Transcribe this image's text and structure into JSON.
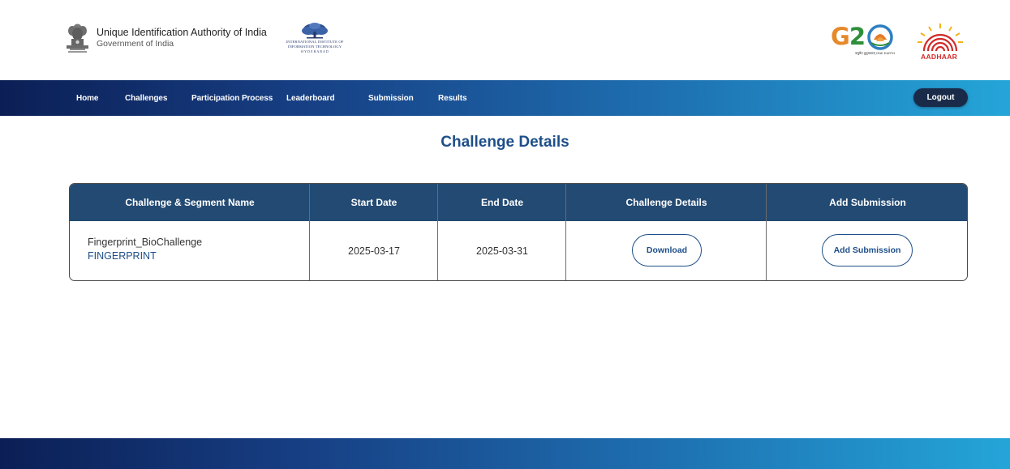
{
  "header": {
    "org_name": "Unique Identification Authority of India",
    "org_sub": "Government of India",
    "iiit_line1": "INTERNATIONAL INSTITUTE OF",
    "iiit_line2": "INFORMATION TECHNOLOGY",
    "iiit_line3": "H Y D E R A B A D",
    "g20_label": "G20",
    "g20_sub": "वसुधैव कुटुम्बकम् ONE EARTH",
    "aadhaar_label": "AADHAAR"
  },
  "nav": {
    "items": [
      "Home",
      "Challenges",
      "Participation Process",
      "Leaderboard",
      "Submission",
      "Results"
    ],
    "logout_label": "Logout"
  },
  "page": {
    "title": "Challenge Details"
  },
  "table": {
    "headers": [
      "Challenge & Segment Name",
      "Start Date",
      "End Date",
      "Challenge Details",
      "Add Submission"
    ],
    "rows": [
      {
        "challenge_name": "Fingerprint_BioChallenge",
        "segment_name": "FINGERPRINT",
        "start_date": "2025-03-17",
        "end_date": "2025-03-31",
        "details_button": "Download",
        "submission_button": "Add Submission"
      }
    ]
  },
  "colors": {
    "accent": "#1d4e89",
    "header_row": "#234a73",
    "nav_start": "#0b1f55",
    "nav_end": "#24a5d8",
    "logout_bg": "#1a2b4a"
  }
}
